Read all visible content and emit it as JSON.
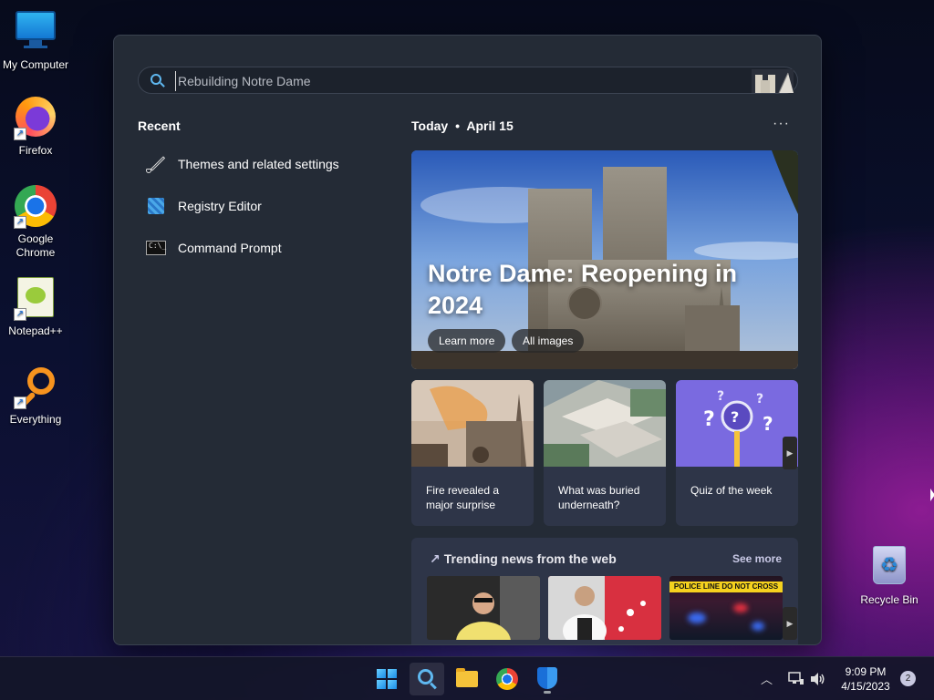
{
  "desktop": {
    "icons": [
      {
        "label": "My Computer",
        "icon": "computer-icon"
      },
      {
        "label": "Firefox",
        "icon": "firefox-icon"
      },
      {
        "label": "Google Chrome",
        "icon": "chrome-icon"
      },
      {
        "label": "Notepad++",
        "icon": "notepadpp-icon"
      },
      {
        "label": "Everything",
        "icon": "everything-icon"
      },
      {
        "label": "Recycle Bin",
        "icon": "recycle-bin-icon"
      }
    ]
  },
  "search": {
    "placeholder": "Rebuilding Notre Dame",
    "value": ""
  },
  "recent": {
    "title": "Recent",
    "items": [
      {
        "label": "Themes and related settings",
        "icon": "paintbrush-icon"
      },
      {
        "label": "Registry Editor",
        "icon": "registry-editor-icon"
      },
      {
        "label": "Command Prompt",
        "icon": "command-prompt-icon"
      }
    ]
  },
  "today": {
    "label": "Today",
    "separator": "•",
    "date": "April 15",
    "more": "···"
  },
  "hero": {
    "title": "Notre Dame: Reopening in 2024",
    "learn_more": "Learn more",
    "all_images": "All images"
  },
  "cards": [
    {
      "caption": "Fire revealed a major surprise"
    },
    {
      "caption": "What was buried underneath?"
    },
    {
      "caption": "Quiz of the week"
    }
  ],
  "trending": {
    "title": "Trending news from the web",
    "see_more": "See more",
    "thumb3_text": "POLICE LINE DO NOT CROSS"
  },
  "taskbar": {
    "time": "9:09 PM",
    "date": "4/15/2023",
    "notifications": "2"
  },
  "colors": {
    "accent": "#5fb8f0",
    "panel": "#242b36",
    "card": "#2e3548"
  }
}
